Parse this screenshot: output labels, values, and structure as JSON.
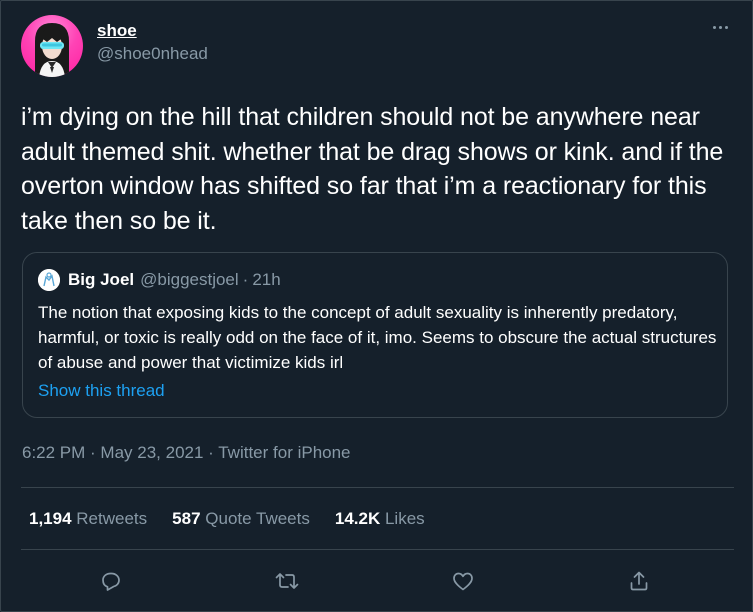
{
  "author": {
    "display_name": "shoe",
    "handle": "@shoe0nhead"
  },
  "tweet": {
    "text": "i’m dying on the hill that children should not be anywhere near adult themed shit. whether that be drag shows or kink. and if the overton window has shifted so far that i’m a reactionary for this take then so be it."
  },
  "quoted_tweet": {
    "display_name": "Big Joel",
    "handle": "@biggestjoel",
    "separator": "·",
    "time": "21h",
    "text": "The notion that exposing kids to the concept of adult sexuality is inherently predatory, harmful, or toxic is really odd on the face of it, imo. Seems to obscure the actual structures of abuse and power that victimize kids irl",
    "show_thread_label": "Show this thread"
  },
  "meta": {
    "line": "6:22 PM · May 23, 2021 · Twitter for iPhone"
  },
  "stats": {
    "retweets_count": "1,194",
    "retweets_label": "Retweets",
    "quotes_count": "587",
    "quotes_label": "Quote Tweets",
    "likes_count": "14.2K",
    "likes_label": "Likes"
  },
  "actions": [
    "reply-icon",
    "retweet-icon",
    "like-icon",
    "share-icon"
  ],
  "colors": {
    "background": "#15202b",
    "border": "#38444d",
    "secondary_text": "#8899a6",
    "link": "#1da1f2",
    "avatar_pink": "#ff43b5"
  }
}
